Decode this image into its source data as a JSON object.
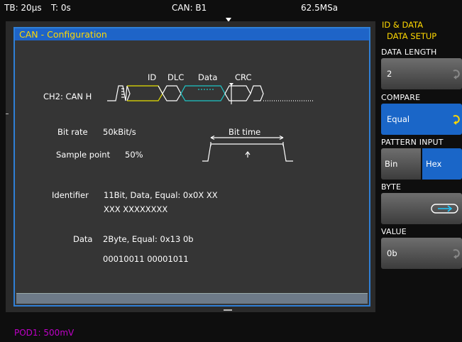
{
  "status": {
    "timebase": "TB: 20µs",
    "trigger_time": "T: 0s",
    "trigger_source": "CAN: B1",
    "sample_rate": "62.5MSa"
  },
  "dialog": {
    "title": "CAN - Configuration",
    "frame_labels": {
      "id": "ID",
      "dlc": "DLC",
      "data": "Data",
      "crc": "CRC"
    },
    "channel": "CH2: CAN H",
    "bit_rate_label": "Bit rate",
    "bit_rate_value": "50kBit/s",
    "sample_point_label": "Sample point",
    "sample_point_value": "50%",
    "bit_time_label": "Bit time",
    "identifier_label": "Identifier",
    "identifier_value": "11Bit, Data, Equal: 0x0X XX",
    "identifier_bits": "XXX  XXXXXXXX",
    "data_label": "Data",
    "data_value": "2Byte, Equal: 0x13 0b",
    "data_bits": "00010011  00001011"
  },
  "bottom_label": "POD1: 500mV",
  "panel": {
    "title_line1": "ID & DATA",
    "title_line2": "DATA SETUP",
    "data_length_label": "DATA LENGTH",
    "data_length_value": "2",
    "compare_label": "COMPARE",
    "compare_value": "Equal",
    "pattern_input_label": "PATTERN INPUT",
    "pattern_bin": "Bin",
    "pattern_hex": "Hex",
    "byte_label": "BYTE",
    "value_label": "VALUE",
    "value_value": "0b"
  },
  "colors": {
    "accent": "#1a66c8",
    "title_text": "#ffd800",
    "pod": "#c000c8"
  },
  "icons": [
    "rotary-knob-icon",
    "byte-select-arrow-icon",
    "trigger-marker-icon"
  ]
}
